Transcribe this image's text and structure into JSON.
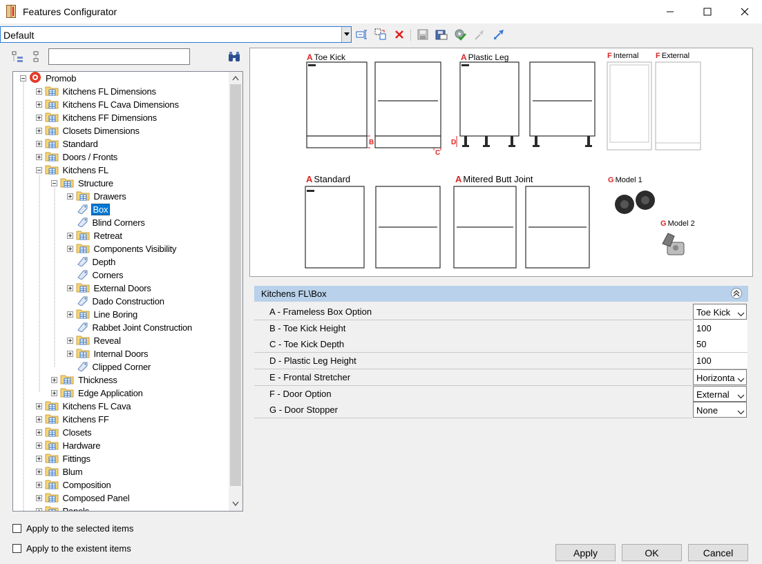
{
  "window": {
    "title": "Features Configurator",
    "icon": "cabinet-app-icon"
  },
  "profile": {
    "value": "Default"
  },
  "toolbar": {
    "icons": [
      "rename-icon",
      "copy-icon",
      "delete-icon",
      "save-icon",
      "save-as-icon",
      "settings-check-icon",
      "collapse-arrow-icon",
      "expand-arrow-icon"
    ]
  },
  "search": {
    "value": "",
    "placeholder": ""
  },
  "tree": {
    "items": [
      {
        "label": "Promob",
        "level": 0,
        "expander": "minus",
        "icon": "promob"
      },
      {
        "label": "Kitchens FL Dimensions",
        "level": 1,
        "expander": "plus",
        "icon": "folder"
      },
      {
        "label": "Kitchens FL Cava Dimensions",
        "level": 1,
        "expander": "plus",
        "icon": "folder"
      },
      {
        "label": "Kitchens FF Dimensions",
        "level": 1,
        "expander": "plus",
        "icon": "folder"
      },
      {
        "label": "Closets Dimensions",
        "level": 1,
        "expander": "plus",
        "icon": "folder"
      },
      {
        "label": "Standard",
        "level": 1,
        "expander": "plus",
        "icon": "folder"
      },
      {
        "label": "Doors / Fronts",
        "level": 1,
        "expander": "plus",
        "icon": "folder"
      },
      {
        "label": "Kitchens FL",
        "level": 1,
        "expander": "minus",
        "icon": "folder"
      },
      {
        "label": "Structure",
        "level": 2,
        "expander": "minus",
        "icon": "folder"
      },
      {
        "label": "Drawers",
        "level": 3,
        "expander": "plus",
        "icon": "folder"
      },
      {
        "label": "Box",
        "level": 3,
        "expander": "none",
        "icon": "tag",
        "selected": true
      },
      {
        "label": "Blind Corners",
        "level": 3,
        "expander": "none",
        "icon": "tag"
      },
      {
        "label": "Retreat",
        "level": 3,
        "expander": "plus",
        "icon": "folder"
      },
      {
        "label": "Components Visibility",
        "level": 3,
        "expander": "plus",
        "icon": "folder"
      },
      {
        "label": "Depth",
        "level": 3,
        "expander": "none",
        "icon": "tag"
      },
      {
        "label": "Corners",
        "level": 3,
        "expander": "none",
        "icon": "tag"
      },
      {
        "label": "External Doors",
        "level": 3,
        "expander": "plus",
        "icon": "folder"
      },
      {
        "label": "Dado Construction",
        "level": 3,
        "expander": "none",
        "icon": "tag"
      },
      {
        "label": "Line Boring",
        "level": 3,
        "expander": "plus",
        "icon": "folder"
      },
      {
        "label": "Rabbet Joint Construction",
        "level": 3,
        "expander": "none",
        "icon": "tag"
      },
      {
        "label": "Reveal",
        "level": 3,
        "expander": "plus",
        "icon": "folder"
      },
      {
        "label": "Internal Doors",
        "level": 3,
        "expander": "plus",
        "icon": "folder"
      },
      {
        "label": "Clipped Corner",
        "level": 3,
        "expander": "none",
        "icon": "tag"
      },
      {
        "label": "Thickness",
        "level": 2,
        "expander": "plus",
        "icon": "folder"
      },
      {
        "label": "Edge Application",
        "level": 2,
        "expander": "plus",
        "icon": "folder"
      },
      {
        "label": "Kitchens FL Cava",
        "level": 1,
        "expander": "plus",
        "icon": "folder"
      },
      {
        "label": "Kitchens FF",
        "level": 1,
        "expander": "plus",
        "icon": "folder"
      },
      {
        "label": "Closets",
        "level": 1,
        "expander": "plus",
        "icon": "folder"
      },
      {
        "label": "Hardware",
        "level": 1,
        "expander": "plus",
        "icon": "folder"
      },
      {
        "label": "Fittings",
        "level": 1,
        "expander": "plus",
        "icon": "folder"
      },
      {
        "label": "Blum",
        "level": 1,
        "expander": "plus",
        "icon": "folder"
      },
      {
        "label": "Composition",
        "level": 1,
        "expander": "plus",
        "icon": "folder"
      },
      {
        "label": "Composed Panel",
        "level": 1,
        "expander": "plus",
        "icon": "folder"
      },
      {
        "label": "Panels",
        "level": 1,
        "expander": "plus",
        "icon": "folder"
      }
    ]
  },
  "options": {
    "apply_selected": "Apply to the selected items",
    "apply_existent": "Apply to the existent items"
  },
  "preview": {
    "captions": {
      "toe_kick": {
        "letter": "A",
        "text": "Toe Kick"
      },
      "plastic_leg": {
        "letter": "A",
        "text": "Plastic Leg"
      },
      "internal": {
        "letter": "F",
        "text": "Internal"
      },
      "external": {
        "letter": "F",
        "text": "External"
      },
      "standard": {
        "letter": "A",
        "text": "Standard"
      },
      "mitered": {
        "letter": "A",
        "text": "Mitered Butt Joint"
      },
      "model1": {
        "letter": "G",
        "text": "Model 1"
      },
      "model2": {
        "letter": "G",
        "text": "Model 2"
      }
    },
    "dim_letters": {
      "b": "B",
      "c": "C",
      "d": "D"
    }
  },
  "property_grid": {
    "header": "Kitchens FL\\Box",
    "rows": [
      {
        "label": "A - Frameless Box Option",
        "value": "Toe Kick",
        "dropdown": true
      },
      {
        "label": "B - Toe Kick Height",
        "value": "100",
        "dropdown": false
      },
      {
        "label": "C - Toe Kick Depth",
        "value": "50",
        "dropdown": false
      },
      {
        "label": "D - Plastic Leg Height",
        "value": "100",
        "dropdown": false
      },
      {
        "label": "E - Frontal Stretcher",
        "value": "Horizontal",
        "dropdown": true
      },
      {
        "label": "F - Door Option",
        "value": "External",
        "dropdown": true
      },
      {
        "label": "G - Door Stopper",
        "value": "None",
        "dropdown": true
      }
    ]
  },
  "buttons": {
    "apply": "Apply",
    "ok": "OK",
    "cancel": "Cancel"
  },
  "colors": {
    "accent": "#0078d7",
    "header": "#b9d1ea",
    "caption_red": "#d22222"
  }
}
